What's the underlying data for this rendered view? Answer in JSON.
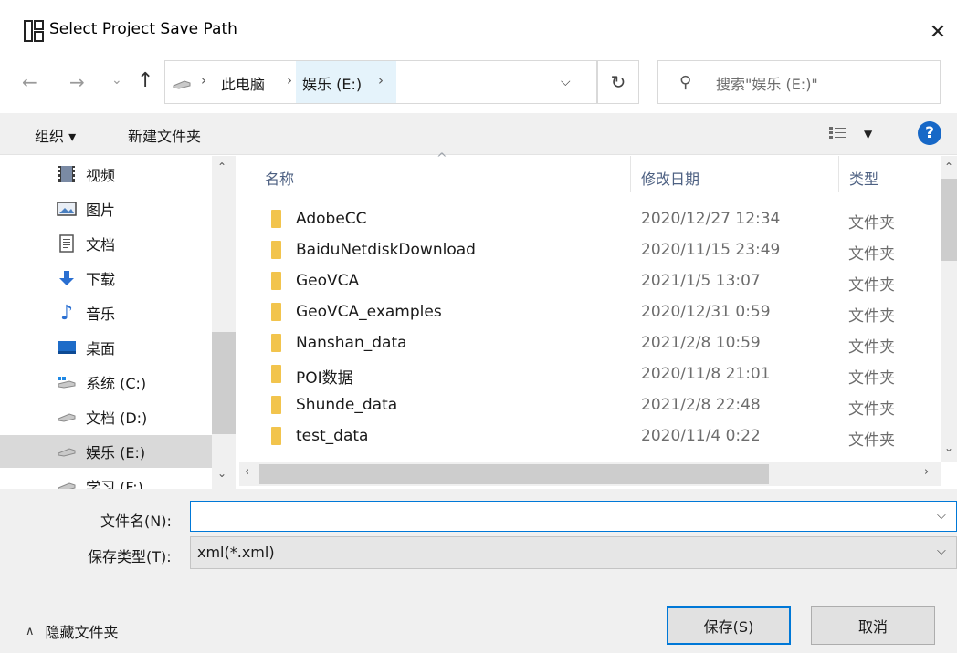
{
  "window": {
    "title": "Select Project Save Path"
  },
  "address_bar": {
    "crumbs": [
      "此电脑",
      "娱乐 (E:)"
    ],
    "search_placeholder": "搜索\"娱乐 (E:)\""
  },
  "toolbar": {
    "organize_label": "组织 ▾",
    "new_folder_label": "新建文件夹"
  },
  "nav_pane": {
    "items": [
      {
        "label": "视频",
        "icon": "video-icon"
      },
      {
        "label": "图片",
        "icon": "pictures-icon"
      },
      {
        "label": "文档",
        "icon": "documents-icon"
      },
      {
        "label": "下载",
        "icon": "download-icon"
      },
      {
        "label": "音乐",
        "icon": "music-icon"
      },
      {
        "label": "桌面",
        "icon": "desktop-icon"
      },
      {
        "label": "系统 (C:)",
        "icon": "system-drive-icon"
      },
      {
        "label": "文档 (D:)",
        "icon": "drive-icon"
      },
      {
        "label": "娱乐 (E:)",
        "icon": "drive-icon",
        "selected": true
      },
      {
        "label": "学习 (F:)",
        "icon": "drive-icon"
      }
    ]
  },
  "file_list": {
    "columns": {
      "name": "名称",
      "modified": "修改日期",
      "type": "类型"
    },
    "rows": [
      {
        "name": "AdobeCC",
        "modified": "2020/12/27 12:34",
        "type": "文件夹"
      },
      {
        "name": "BaiduNetdiskDownload",
        "modified": "2020/11/15 23:49",
        "type": "文件夹"
      },
      {
        "name": "GeoVCA",
        "modified": "2021/1/5 13:07",
        "type": "文件夹"
      },
      {
        "name": "GeoVCA_examples",
        "modified": "2020/12/31 0:59",
        "type": "文件夹"
      },
      {
        "name": "Nanshan_data",
        "modified": "2021/2/8 10:59",
        "type": "文件夹"
      },
      {
        "name": "POI数据",
        "modified": "2020/11/8 21:01",
        "type": "文件夹"
      },
      {
        "name": "Shunde_data",
        "modified": "2021/2/8 22:48",
        "type": "文件夹"
      },
      {
        "name": "test_data",
        "modified": "2020/11/4 0:22",
        "type": "文件夹"
      }
    ]
  },
  "form": {
    "filename_label": "文件名(N):",
    "filename_value": "",
    "filetype_label": "保存类型(T):",
    "filetype_value": "xml(*.xml)"
  },
  "footer": {
    "hide_folders_label": "隐藏文件夹",
    "save_label": "保存(S)",
    "cancel_label": "取消"
  },
  "colors": {
    "accent": "#0078d7",
    "selection": "#d9d9d9",
    "crumb_highlight": "#e5f3fb",
    "folder": "#f2c44d",
    "help": "#1768c7"
  }
}
